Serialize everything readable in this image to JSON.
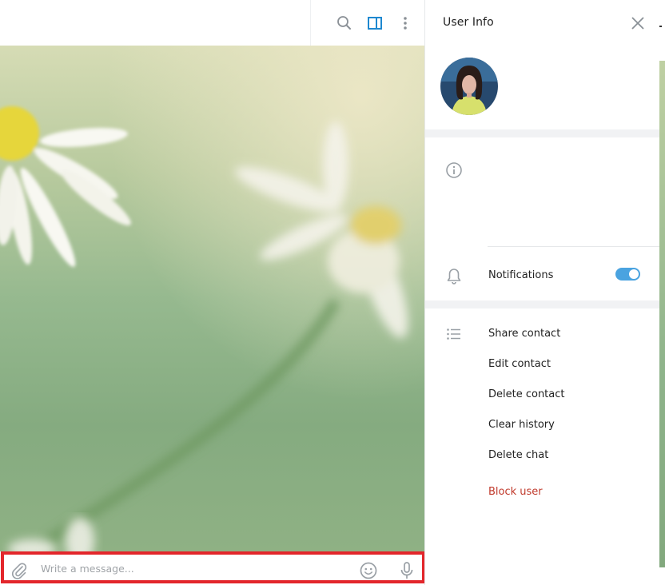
{
  "header": {
    "icons": [
      "search-icon",
      "sidebar-toggle-icon",
      "more-vertical-icon"
    ],
    "accent": "#1e88d0"
  },
  "composer": {
    "placeholder": "Write a message...",
    "highlight_color": "#e3262b"
  },
  "user_info": {
    "title": "User Info",
    "notifications": {
      "label": "Notifications",
      "enabled": true
    },
    "actions": [
      {
        "label": "Share contact"
      },
      {
        "label": "Edit contact"
      },
      {
        "label": "Delete contact"
      },
      {
        "label": "Clear history"
      },
      {
        "label": "Delete chat"
      },
      {
        "label": "Block user",
        "danger": true
      }
    ],
    "toggle_color": "#4aa3e0",
    "danger_color": "#c0392b"
  }
}
